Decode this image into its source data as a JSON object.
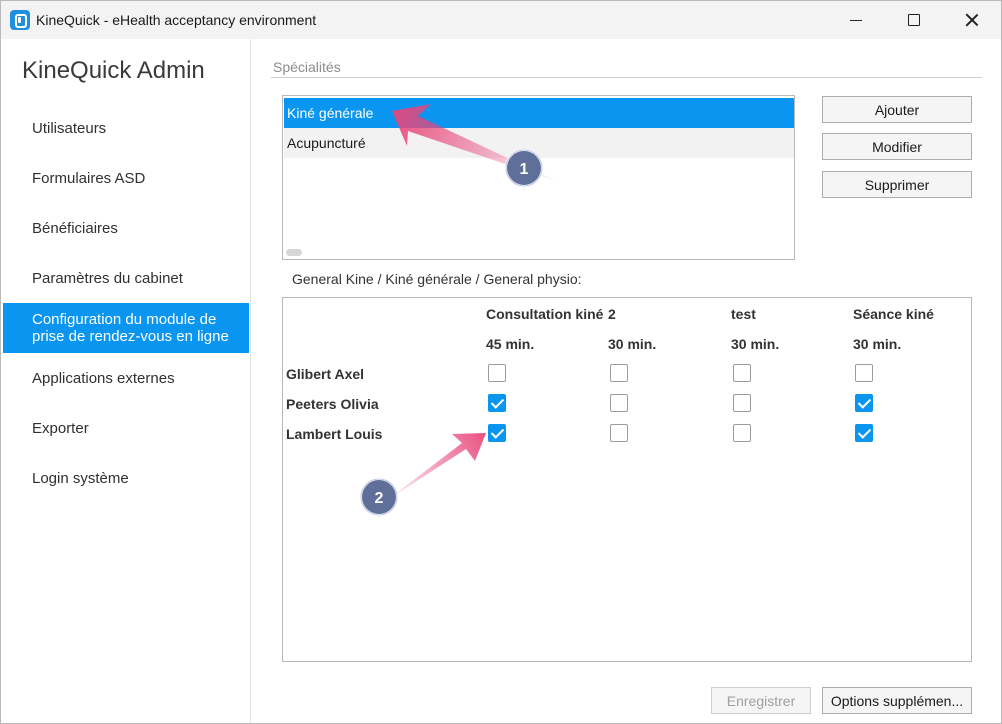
{
  "window": {
    "title": "KineQuick - eHealth acceptancy environment",
    "icon": "app-logo-icon"
  },
  "sidebar": {
    "title": "KineQuick Admin",
    "items": [
      {
        "label": "Utilisateurs",
        "active": false
      },
      {
        "label": "Formulaires ASD",
        "active": false
      },
      {
        "label": "Bénéficiaires",
        "active": false
      },
      {
        "label": "Paramètres du cabinet",
        "active": false
      },
      {
        "label": "Configuration du module de prise de rendez-vous en ligne",
        "active": true
      },
      {
        "label": "Applications externes",
        "active": false
      },
      {
        "label": "Exporter",
        "active": false
      },
      {
        "label": "Login système",
        "active": false
      }
    ]
  },
  "specialities": {
    "section_title": "Spécialités",
    "items": [
      {
        "label": "Kiné générale",
        "selected": true
      },
      {
        "label": "Acupuncturé",
        "selected": false
      }
    ],
    "buttons": {
      "add": "Ajouter",
      "edit": "Modifier",
      "delete": "Supprimer"
    }
  },
  "grid": {
    "caption": "General Kine / Kiné générale / General physio:",
    "columns": [
      {
        "name": "Consultation kiné",
        "duration": "45 min."
      },
      {
        "name": "2",
        "duration": "30 min."
      },
      {
        "name": "test",
        "duration": "30 min."
      },
      {
        "name": "Séance kiné",
        "duration": "30 min."
      }
    ],
    "rows": [
      {
        "name": "Glibert Axel",
        "checks": [
          false,
          false,
          false,
          false
        ]
      },
      {
        "name": "Peeters Olivia",
        "checks": [
          true,
          false,
          false,
          true
        ]
      },
      {
        "name": "Lambert Louis",
        "checks": [
          true,
          false,
          false,
          true
        ]
      }
    ]
  },
  "footer": {
    "save": "Enregistrer",
    "options": "Options supplémen..."
  },
  "annotations": {
    "marker_1": "1",
    "marker_2": "2",
    "arrow_color": "#e8457a",
    "marker_color": "#5f6f9a"
  },
  "colors": {
    "accent": "#0a96f0"
  }
}
